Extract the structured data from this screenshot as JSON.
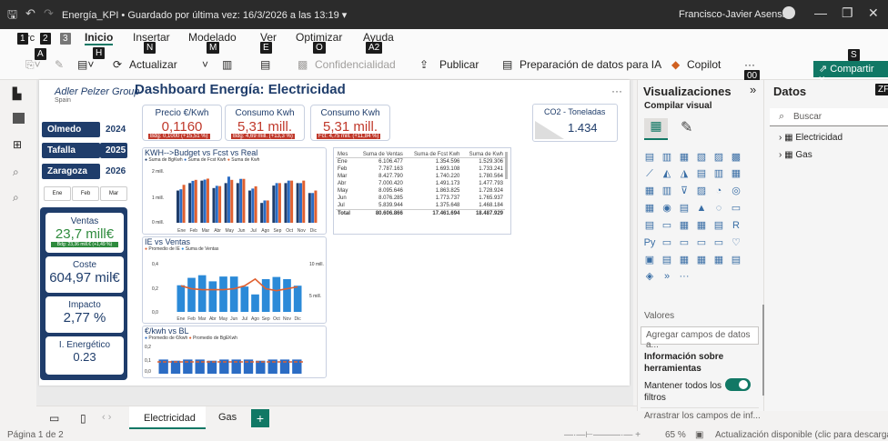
{
  "titlebar": {
    "title": "Energía_KPI • Guardado por última vez: 16/3/2026 a las 13:19 ▾",
    "user": "Francisco-Javier Asensio"
  },
  "ribbon": {
    "tabs": [
      {
        "key": "1",
        "label": "rc"
      },
      {
        "key": "2",
        "label": ""
      },
      {
        "key": "3",
        "label": ""
      },
      {
        "key": "H",
        "label": "Inicio"
      },
      {
        "key": "N",
        "label": "Insertar"
      },
      {
        "key": "M",
        "label": "Modelado"
      },
      {
        "key": "E",
        "label": "Ver"
      },
      {
        "key": "O",
        "label": "Optimizar"
      },
      {
        "key": "A2",
        "label": "Ayuda"
      }
    ],
    "file_key": "A",
    "actualizar": "Actualizar",
    "confidencialidad": "Confidencialidad",
    "publicar": "Publicar",
    "preparacion": "Preparación de datos para IA",
    "copilot": "Copilot",
    "more": "···",
    "more_key": "00",
    "share": "Compartir",
    "share_key": "S",
    "zf": "ZF"
  },
  "report": {
    "title": "Dashboard Energía: Electricidad",
    "logo": "Adler Pelzer Group",
    "logo_sub": "Spain",
    "cards": [
      {
        "h": "Precio €/Kwh",
        "v": "0,1160",
        "sub": "Bdg: 0,1000 (+15,51 %)"
      },
      {
        "h": "Consumo Kwh",
        "v": "5,31 mill.",
        "sub": "Bdg: 4,69 mill. (+13,3 %)"
      },
      {
        "h": "Consumo Kwh",
        "v": "5,31 mill.",
        "sub": "Fct: 4,75 mill. (+11,84 %)"
      }
    ],
    "co2": {
      "h": "CO2 - Toneladas",
      "v": "1.434"
    },
    "slicers": [
      {
        "plant": "Olmedo",
        "year": "2024"
      },
      {
        "plant": "Tafalla",
        "year": "2025"
      },
      {
        "plant": "Zaragoza",
        "year": "2026"
      }
    ],
    "months": [
      "Ene",
      "Feb",
      "Mar"
    ],
    "kpis": [
      {
        "h": "Ventas",
        "v": "23,7 mill€",
        "sub": "Bdg: 23,36 mill.€ (+1,49 %)"
      },
      {
        "h": "Coste",
        "v": "604,97 mil€"
      },
      {
        "h": "Impacto",
        "v": "2,77 %"
      },
      {
        "h": "I. Energético",
        "v": "0.23"
      }
    ],
    "chart1": {
      "title": "KWH-->Budget vs Fcst vs Real",
      "legend": [
        "Suma de BgKwh",
        "Suma de Fcst Kwh",
        "Suma de Kwh"
      ],
      "ytick_top": "2 mill.",
      "ytick_mid": "1 mill.",
      "ytick_bot": "0 mill."
    },
    "chart2": {
      "title": "IE vs Ventas",
      "legend": [
        "Promedio de IE",
        "Suma de Ventas"
      ],
      "ytick_top": "0,4",
      "ytick_mid": "0,2",
      "ytick_bot": "0,0",
      "ryt": "10 mill.",
      "rym": "5 mill."
    },
    "chart3": {
      "title": "€/kwh vs BL",
      "legend": [
        "Promedio de €/kwh",
        "Promedio de BgEKwh"
      ],
      "ytick_top": "0,2",
      "ytick_mid": "0,1",
      "ytick_bot": "0,0"
    },
    "table": {
      "headers": [
        "Mes",
        "Suma de Ventas",
        "Suma de Fcst Kwh",
        "Suma de Kwh"
      ],
      "rows": [
        [
          "Ene",
          "6.106.477",
          "1.354.596",
          "1.529.306"
        ],
        [
          "Feb",
          "7.787.163",
          "1.693.108",
          "1.733.241"
        ],
        [
          "Mar",
          "8.427.790",
          "1.740.220",
          "1.780.564"
        ],
        [
          "Abr",
          "7.000.420",
          "1.491.173",
          "1.477.793"
        ],
        [
          "May",
          "8.095.646",
          "1.863.825",
          "1.728.924"
        ],
        [
          "Jun",
          "8.076.285",
          "1.773.737",
          "1.765.937"
        ],
        [
          "Jul",
          "5.839.944",
          "1.375.648",
          "1.468.184"
        ]
      ],
      "total": [
        "Total",
        "80.606.866",
        "17.461.694",
        "18.487.929"
      ]
    },
    "more": "···"
  },
  "chart_data": [
    {
      "type": "bar",
      "title": "KWH-->Budget vs Fcst vs Real",
      "categories": [
        "Ene",
        "Feb",
        "Mar",
        "Abr",
        "May",
        "Jun",
        "Jul",
        "Ago",
        "Sep",
        "Oct",
        "Nov",
        "Dic"
      ],
      "series": [
        {
          "name": "Suma de BgKwh",
          "values": [
            1.3,
            1.6,
            1.7,
            1.4,
            1.6,
            1.6,
            1.3,
            0.8,
            1.5,
            1.6,
            1.6,
            1.2
          ]
        },
        {
          "name": "Suma de Fcst Kwh",
          "values": [
            1.35,
            1.69,
            1.74,
            1.49,
            1.86,
            1.77,
            1.38,
            0.9,
            1.6,
            1.7,
            1.6,
            1.2
          ]
        },
        {
          "name": "Suma de Kwh",
          "values": [
            1.53,
            1.73,
            1.78,
            1.48,
            1.73,
            1.77,
            1.47,
            0.9,
            1.6,
            1.7,
            1.7,
            1.3
          ]
        }
      ],
      "ylim": [
        0,
        2.2
      ],
      "colors": [
        "#1f3d6b",
        "#2b6cc4",
        "#e06030"
      ]
    },
    {
      "type": "bar",
      "title": "IE vs Ventas",
      "categories": [
        "Ene",
        "Feb",
        "Mar",
        "Abr",
        "May",
        "Jun",
        "Jul",
        "Ago",
        "Sep",
        "Oct",
        "Nov",
        "Dic"
      ],
      "series": [
        {
          "name": "Suma de Ventas",
          "values": [
            6.1,
            7.8,
            8.4,
            7.0,
            8.1,
            8.1,
            5.8,
            4.0,
            7.5,
            8.0,
            7.5,
            6.0
          ]
        },
        {
          "name": "Promedio de IE",
          "values": [
            0.25,
            0.22,
            0.21,
            0.21,
            0.21,
            0.22,
            0.25,
            0.32,
            0.22,
            0.2,
            0.22,
            0.24
          ]
        }
      ],
      "ylim": [
        0,
        0.45
      ],
      "colors": [
        "#2b8ad8",
        "#e06030"
      ]
    },
    {
      "type": "bar",
      "title": "€/kwh vs BL",
      "categories": [
        "Ene",
        "Feb",
        "Mar",
        "Abr",
        "May",
        "Jun",
        "Jul",
        "Ago",
        "Sep",
        "Oct",
        "Nov",
        "Dic"
      ],
      "series": [
        {
          "name": "Promedio de €/kwh",
          "values": [
            0.12,
            0.11,
            0.12,
            0.12,
            0.11,
            0.12,
            0.12,
            0.12,
            0.11,
            0.12,
            0.12,
            0.12
          ]
        },
        {
          "name": "Promedio de BgEKwh",
          "values": [
            0.1,
            0.1,
            0.1,
            0.1,
            0.1,
            0.1,
            0.1,
            0.1,
            0.1,
            0.1,
            0.1,
            0.1
          ]
        }
      ],
      "ylim": [
        0,
        0.2
      ],
      "colors": [
        "#2b6cc4",
        "#e06030"
      ]
    }
  ],
  "viz": {
    "title": "Visualizaciones",
    "compilar": "Compilar visual",
    "valores": "Valores",
    "agregar": "Agregar campos de datos a...",
    "info": "Información sobre herramientas",
    "mantener": "Mantener todos los filtros",
    "arrastrar": "Arrastrar los campos de inf...",
    "icons": [
      "▤",
      "▥",
      "▦",
      "▧",
      "▨",
      "▩",
      "⟋",
      "◭",
      "◮",
      "▤",
      "▥",
      "▦",
      "▦",
      "▥",
      "⊽",
      "▨",
      "◔",
      "◎",
      "▦",
      "◉",
      "▤",
      "▲",
      "◌",
      "▭",
      "▤",
      "▭",
      "▦",
      "▦",
      "▤",
      "R",
      "Py",
      "▭",
      "▭",
      "▭",
      "▭",
      "♡",
      "▣",
      "▤",
      "▦",
      "▦",
      "▦",
      "▤",
      "◈",
      "»",
      "···"
    ]
  },
  "datos": {
    "title": "Datos",
    "search": "Buscar",
    "tables": [
      "Electricidad",
      "Gas"
    ]
  },
  "pages": {
    "tabs": [
      "Electricidad",
      "Gas"
    ],
    "add": "+"
  },
  "status": {
    "page": "Página 1 de 2",
    "zoom": "65 %",
    "update": "Actualización disponible (clic para descargar)"
  }
}
